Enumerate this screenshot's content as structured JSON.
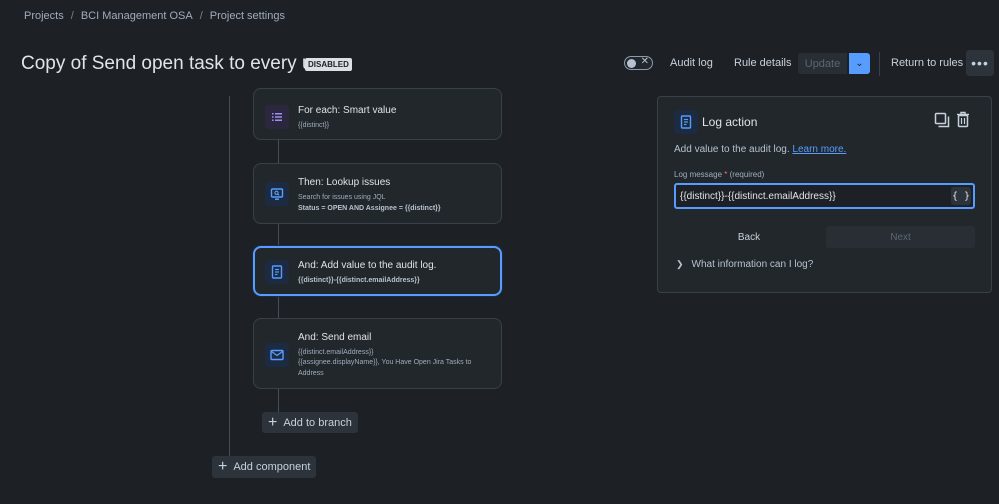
{
  "breadcrumb": [
    {
      "label": "Projects"
    },
    {
      "label": "BCI Management OSA"
    },
    {
      "label": "Project settings"
    }
  ],
  "breadcrumb_separator": "/",
  "header": {
    "title": "Copy of Send open task to every user",
    "status_badge": "DISABLED",
    "toggle_x": "✕",
    "audit_log": "Audit log",
    "rule_details": "Rule details",
    "update": "Update",
    "update_caret": "⌄",
    "return_to_rules": "Return to rules",
    "more": "•••"
  },
  "flow": {
    "cards": [
      {
        "title": "For each: Smart value",
        "sub1": "{{distinct}}",
        "icon": "list-icon"
      },
      {
        "title": "Then: Lookup issues",
        "sub1": "Search for issues using JQL",
        "sub2": "Status = OPEN AND Assignee = {{distinct}}",
        "icon": "monitor-search-icon"
      },
      {
        "title": "And: Add value to the audit log.",
        "sub1": "{{distinct}}-{{distinct.emailAddress}}",
        "icon": "document-icon"
      },
      {
        "title": "And: Send email",
        "sub1": "{{distinct.emailAddress}}",
        "sub2": "{{assignee.displayName}}, You Have Open Jira Tasks to Address",
        "icon": "mail-icon"
      }
    ],
    "add_to_branch": "Add to branch",
    "add_component": "Add component"
  },
  "panel": {
    "title": "Log action",
    "description": "Add value to the audit log.",
    "learn_more": "Learn more.",
    "field_label": "Log message",
    "required_star": "*",
    "required_text": "(required)",
    "field_value": "{{distinct}}-{{distinct.emailAddress}}",
    "smart_value_button": "{ }",
    "back": "Back",
    "next": "Next",
    "faq": "What information can I log?"
  },
  "colors": {
    "background": "#1d2125",
    "accent": "#579dff",
    "card": "#22272b"
  }
}
